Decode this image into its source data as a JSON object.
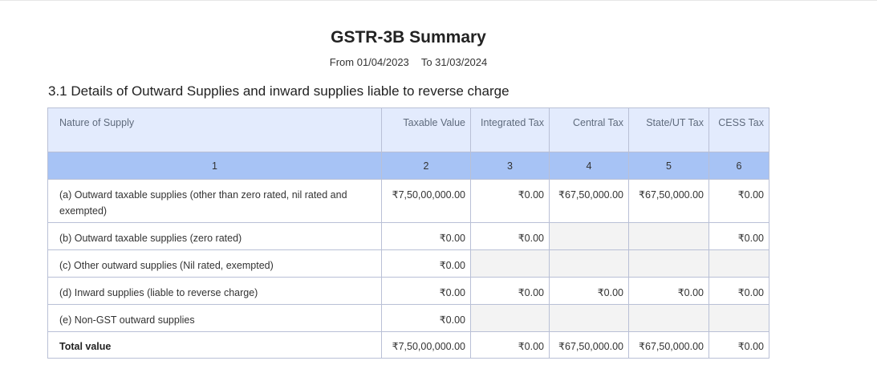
{
  "report": {
    "title": "GSTR-3B Summary",
    "period_from_label": "From",
    "period_from": "01/04/2023",
    "period_to_label": "To",
    "period_to": "31/03/2024"
  },
  "section": {
    "heading": "3.1 Details of Outward Supplies and inward supplies liable to reverse charge"
  },
  "table": {
    "headers": [
      "Nature of Supply",
      "Taxable Value",
      "Integrated Tax",
      "Central Tax",
      "State/UT Tax",
      "CESS Tax"
    ],
    "column_numbers": [
      "1",
      "2",
      "3",
      "4",
      "5",
      "6"
    ],
    "rows": [
      {
        "label": "(a) Outward taxable supplies (other than zero rated, nil rated and exempted)",
        "taxable_value": "₹7,50,00,000.00",
        "integrated_tax": "₹0.00",
        "central_tax": "₹67,50,000.00",
        "state_ut_tax": "₹67,50,000.00",
        "cess_tax": "₹0.00"
      },
      {
        "label": "(b) Outward taxable supplies (zero rated)",
        "taxable_value": "₹0.00",
        "integrated_tax": "₹0.00",
        "central_tax": "",
        "state_ut_tax": "",
        "cess_tax": "₹0.00"
      },
      {
        "label": "(c) Other outward supplies (Nil rated, exempted)",
        "taxable_value": "₹0.00",
        "integrated_tax": "",
        "central_tax": "",
        "state_ut_tax": "",
        "cess_tax": ""
      },
      {
        "label": "(d) Inward supplies (liable to reverse charge)",
        "taxable_value": "₹0.00",
        "integrated_tax": "₹0.00",
        "central_tax": "₹0.00",
        "state_ut_tax": "₹0.00",
        "cess_tax": "₹0.00"
      },
      {
        "label": "(e) Non-GST outward supplies",
        "taxable_value": "₹0.00",
        "integrated_tax": "",
        "central_tax": "",
        "state_ut_tax": "",
        "cess_tax": ""
      }
    ],
    "total": {
      "label": "Total value",
      "taxable_value": "₹7,50,00,000.00",
      "integrated_tax": "₹0.00",
      "central_tax": "₹67,50,000.00",
      "state_ut_tax": "₹67,50,000.00",
      "cess_tax": "₹0.00"
    }
  },
  "colors": {
    "header_bg": "#e3ebfd",
    "number_row_bg": "#a7c3f5",
    "disabled_cell_bg": "#f3f3f3",
    "border": "#b9c0d6"
  }
}
